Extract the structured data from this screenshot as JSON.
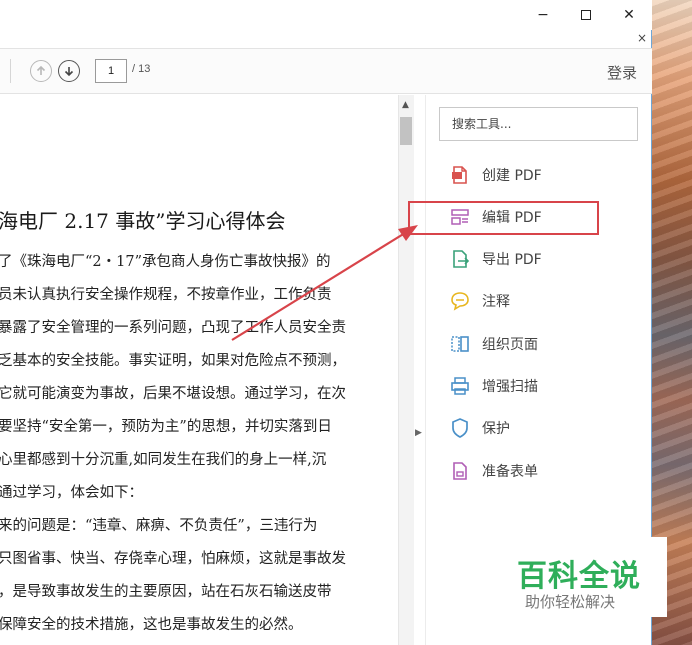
{
  "window": {
    "minimize_glyph": "−",
    "close_glyph": "✕",
    "tab_close_glyph": "×"
  },
  "toolbar": {
    "page_current": "1",
    "page_total": "/ 13",
    "login_label": "登录"
  },
  "document": {
    "title": "海电厂 2.17 事故”学习心得体会",
    "lines": [
      "了《珠海电厂“2・17”承包商人身伤亡事故快报》的",
      "员未认真执行安全操作规程，不按章作业，工作负责",
      "暴露了安全管理的一系列问题，凸现了工作人员安全责",
      "乏基本的安全技能。事实证明，如果对危险点不预测，",
      "它就可能演变为事故，后果不堪设想。通过学习，在次",
      "要坚持“安全第一，预防为主”的思想，并切实落到日",
      "心里都感到十分沉重,如同发生在我们的身上一样,沉",
      "通过学习，体会如下：",
      "来的问题是：“违章、麻痹、不负责任”，三违行为",
      "只图省事、快当、存侥幸心理，怕麻烦，这就是事故发",
      "，是导致事故发生的主要原因，站在石灰石输送皮带",
      "保障安全的技术措施，这也是事故发生的必然。"
    ]
  },
  "tools_pane": {
    "search_placeholder": "搜索工具...",
    "items": [
      {
        "label": "创建 PDF",
        "icon": "create-pdf-icon"
      },
      {
        "label": "编辑 PDF",
        "icon": "edit-pdf-icon"
      },
      {
        "label": "导出 PDF",
        "icon": "export-pdf-icon"
      },
      {
        "label": "注释",
        "icon": "comment-icon"
      },
      {
        "label": "组织页面",
        "icon": "organize-pages-icon"
      },
      {
        "label": "增强扫描",
        "icon": "enhance-scan-icon"
      },
      {
        "label": "保护",
        "icon": "protect-shield-icon"
      },
      {
        "label": "准备表单",
        "icon": "prepare-form-icon"
      }
    ]
  },
  "watermark": {
    "main": "百科全说",
    "sub": "助你轻松解决"
  },
  "colors": {
    "highlight": "#d8444a",
    "arrow": "#d8444a",
    "watermark_green": "#2fae5a",
    "icon_red": "#d9534f",
    "icon_purple": "#b05fb5",
    "icon_green": "#3aa27a",
    "icon_yellow": "#e8b61f",
    "icon_blue": "#4a90c8"
  }
}
